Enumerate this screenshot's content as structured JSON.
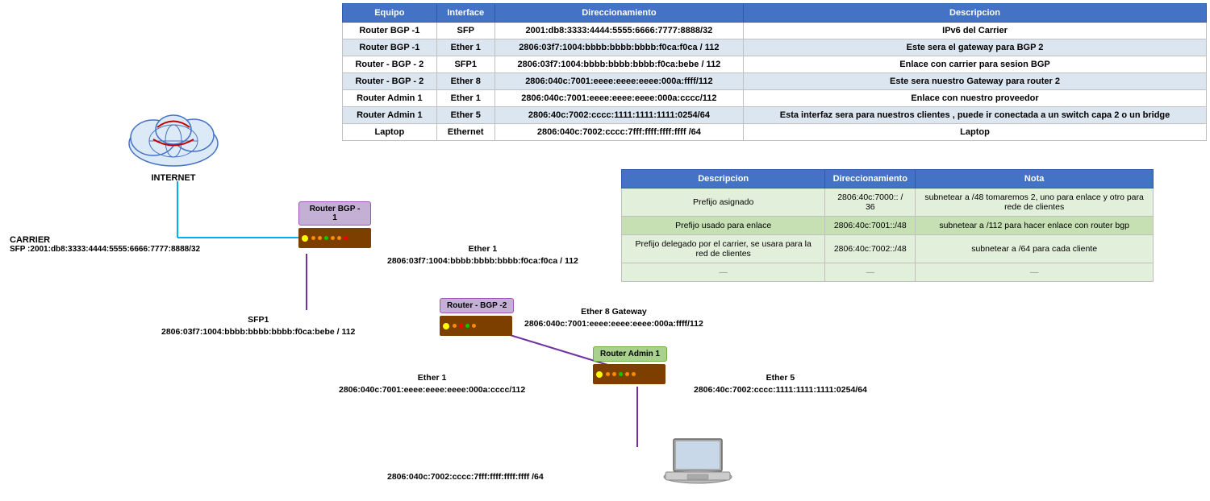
{
  "mainTable": {
    "headers": [
      "Equipo",
      "Interface",
      "Direccionamiento",
      "Descripcion"
    ],
    "rows": [
      [
        "Router BGP -1",
        "SFP",
        "2001:db8:3333:4444:5555:6666:7777:8888/32",
        "IPv6 del Carrier"
      ],
      [
        "Router BGP -1",
        "Ether 1",
        "2806:03f7:1004:bbbb:bbbb:bbbb:f0ca:f0ca / 112",
        "Este sera el gateway para BGP 2"
      ],
      [
        "Router - BGP - 2",
        "SFP1",
        "2806:03f7:1004:bbbb:bbbb:bbbb:f0ca:bebe / 112",
        "Enlace con carrier para sesion BGP"
      ],
      [
        "Router - BGP - 2",
        "Ether 8",
        "2806:040c:7001:eeee:eeee:eeee:000a:ffff/112",
        "Este sera nuestro Gateway para router 2"
      ],
      [
        "Router Admin 1",
        "Ether 1",
        "2806:040c:7001:eeee:eeee:eeee:000a:cccc/112",
        "Enlace con nuestro proveedor"
      ],
      [
        "Router Admin 1",
        "Ether 5",
        "2806:40c:7002:cccc:1111:1111:1111:0254/64",
        "Esta interfaz sera para nuestros clientes , puede ir conectada a un switch capa 2 o un bridge"
      ],
      [
        "Laptop",
        "Ethernet",
        "2806:040c:7002:cccc:7fff:ffff:ffff:ffff /64",
        "Laptop"
      ]
    ]
  },
  "secondTable": {
    "headers": [
      "Descripcion",
      "Direccionamiento",
      "Nota"
    ],
    "rows": [
      [
        "Prefijo asignado",
        "2806:40c:7000:: / 36",
        "subnetear a /48  tomaremos 2, uno para enlace y otro para rede de clientes"
      ],
      [
        "Prefijo usado para enlace",
        "2806:40c:7001::/48",
        "subnetear a /112 para hacer enlace con router bgp"
      ],
      [
        "Prefijo delegado por el carrier, se usara para la red de clientes",
        "2806:40c:7002::/48",
        "subnetear a /64 para cada cliente"
      ],
      [
        "—",
        "—",
        "—"
      ]
    ]
  },
  "diagram": {
    "internet_label": "INTERNET",
    "carrier_label": "CARRIER",
    "carrier_sfp": "SFP :2001:db8:3333:4444:5555:6666:7777:8888/32",
    "router_bgp1_label": "Router BGP -\n1",
    "ether1_top_label": "Ether 1",
    "ether1_top_addr": "2806:03f7:1004:bbbb:bbbb:bbbb:f0ca:f0ca / 112",
    "router_bgp2_label": "Router - BGP -2",
    "sfp1_label": "SFP1",
    "sfp1_addr": "2806:03f7:1004:bbbb:bbbb:bbbb:f0ca:bebe / 112",
    "ether8_label": "Ether 8 Gateway",
    "ether8_addr": "2806:040c:7001:eeee:eeee:eeee:000a:ffff/112",
    "router_admin1_label": "Router Admin 1",
    "ether1_bottom_label": "Ether 1",
    "ether1_bottom_addr": "2806:040c:7001:eeee:eeee:eeee:000a:cccc/112",
    "ether5_label": "Ether 5",
    "ether5_addr": "2806:40c:7002:cccc:1111:1111:1111:0254/64",
    "laptop_addr": "2806:040c:7002:cccc:7fff:ffff:ffff:ffff /64",
    "laptop_label": "Laptop"
  }
}
